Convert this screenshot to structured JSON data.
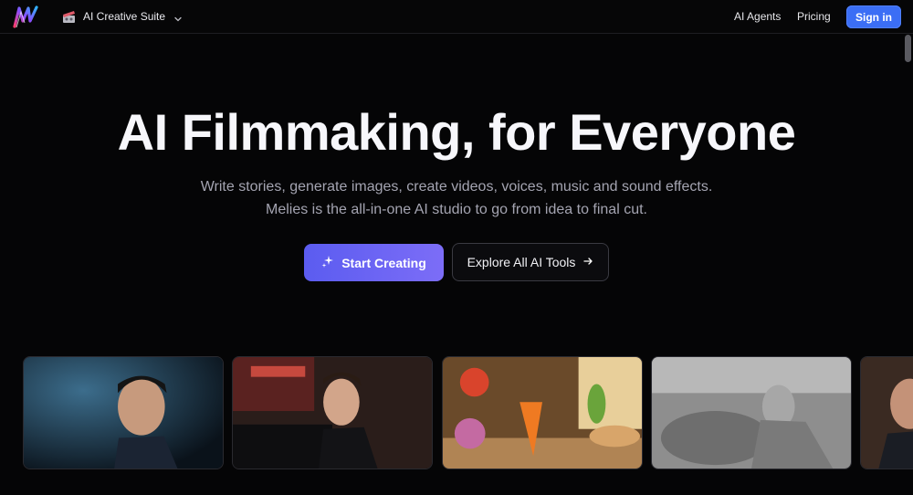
{
  "header": {
    "suite_label": "AI Creative Suite",
    "nav": [
      {
        "label": "AI Agents"
      },
      {
        "label": "Pricing"
      }
    ],
    "signin_label": "Sign in"
  },
  "hero": {
    "title": "AI Filmmaking, for Everyone",
    "subtitle_line1": "Write stories, generate images, create videos, voices, music and sound effects.",
    "subtitle_line2": "Melies is the all-in-one AI studio to go from idea to final cut.",
    "primary_cta": "Start Creating",
    "secondary_cta": "Explore All AI Tools"
  },
  "colors": {
    "background": "#050506",
    "accent": "#3b6ef5",
    "primary_button": "#6a63f3"
  },
  "icons": {
    "logo": "melies-logo-icon",
    "suite": "film-clapper-icon",
    "chevron": "chevron-down-icon",
    "sparkle": "sparkle-icon",
    "arrow": "arrow-right-icon"
  }
}
